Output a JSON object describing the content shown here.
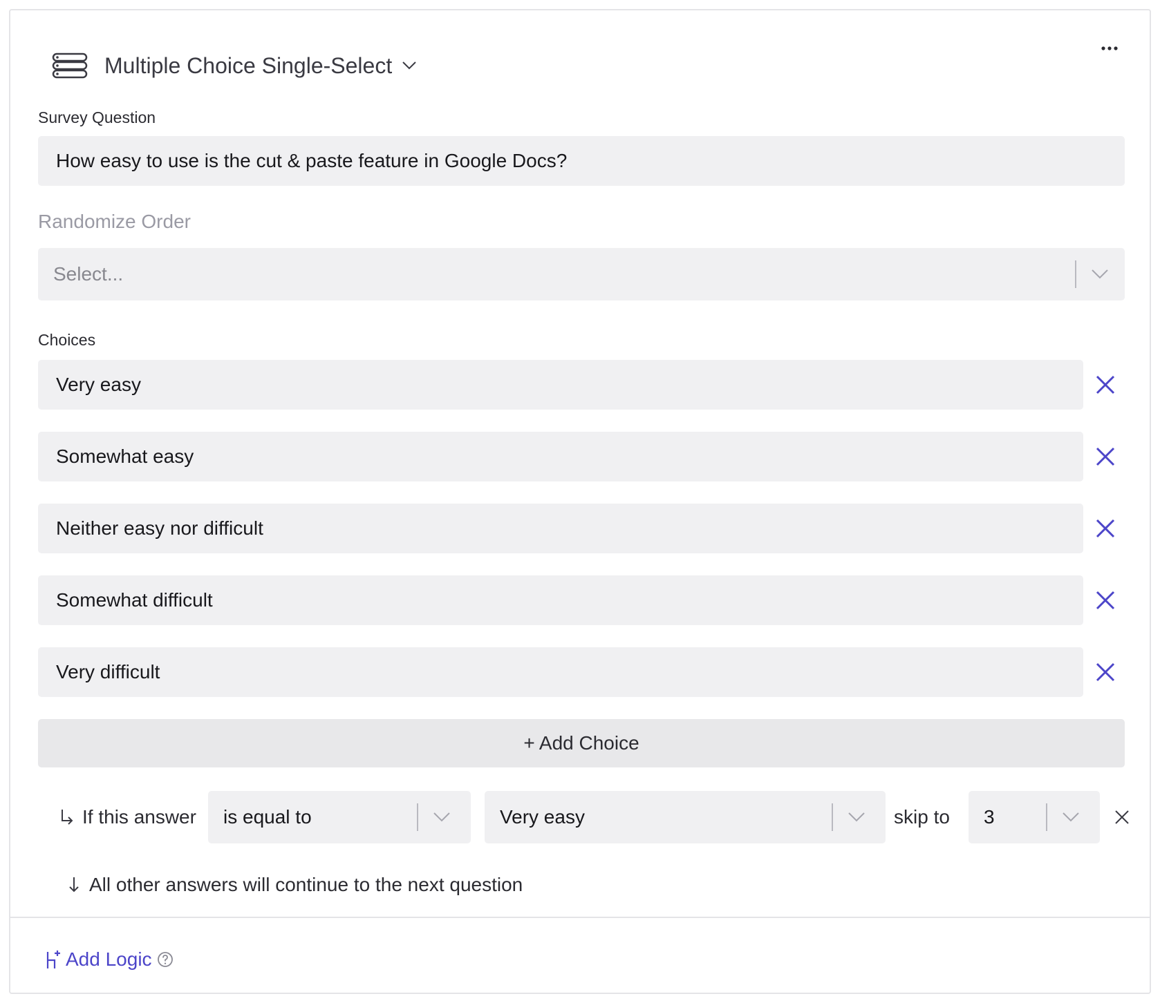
{
  "header": {
    "question_type": "Multiple Choice Single-Select"
  },
  "survey_question": {
    "label": "Survey Question",
    "value": "How easy to use is the cut & paste feature in Google Docs?"
  },
  "randomize": {
    "label": "Randomize Order",
    "placeholder": "Select..."
  },
  "choices": {
    "label": "Choices",
    "items": [
      "Very easy",
      "Somewhat easy",
      "Neither easy nor difficult",
      "Somewhat difficult",
      "Very difficult"
    ],
    "add_label": "+ Add Choice"
  },
  "logic": {
    "prefix": "If this answer",
    "operator": "is equal to",
    "answer": "Very easy",
    "skip_label": "skip to",
    "target": "3",
    "fallback": "All other answers will continue to the next question"
  },
  "footer": {
    "add_logic_label": "Add Logic"
  },
  "colors": {
    "accent": "#4c45c9",
    "field_bg": "#f0f0f2",
    "button_bg": "#e8e8ea",
    "border": "#e4e4e7"
  }
}
